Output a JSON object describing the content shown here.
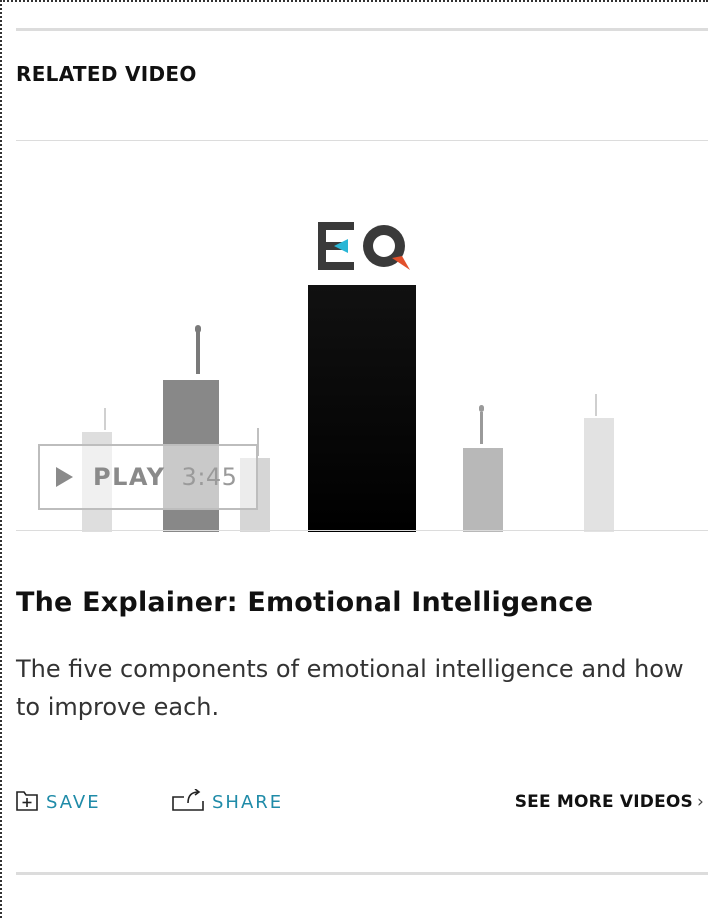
{
  "section": {
    "title": "RELATED VIDEO"
  },
  "video": {
    "logo_text": "EQ",
    "play_label": "PLAY",
    "duration": "3:45",
    "title": "The Explainer: Emotional Intelligence",
    "description": "The five components of emotional intelligence and how to improve each."
  },
  "actions": {
    "save_label": "SAVE",
    "share_label": "SHARE",
    "see_more_label": "SEE MORE VIDEOS",
    "see_more_chevron": "›"
  },
  "colors": {
    "accent": "#1f8ba8",
    "logo_cyan": "#29b6d6",
    "logo_orange": "#e2502b"
  }
}
